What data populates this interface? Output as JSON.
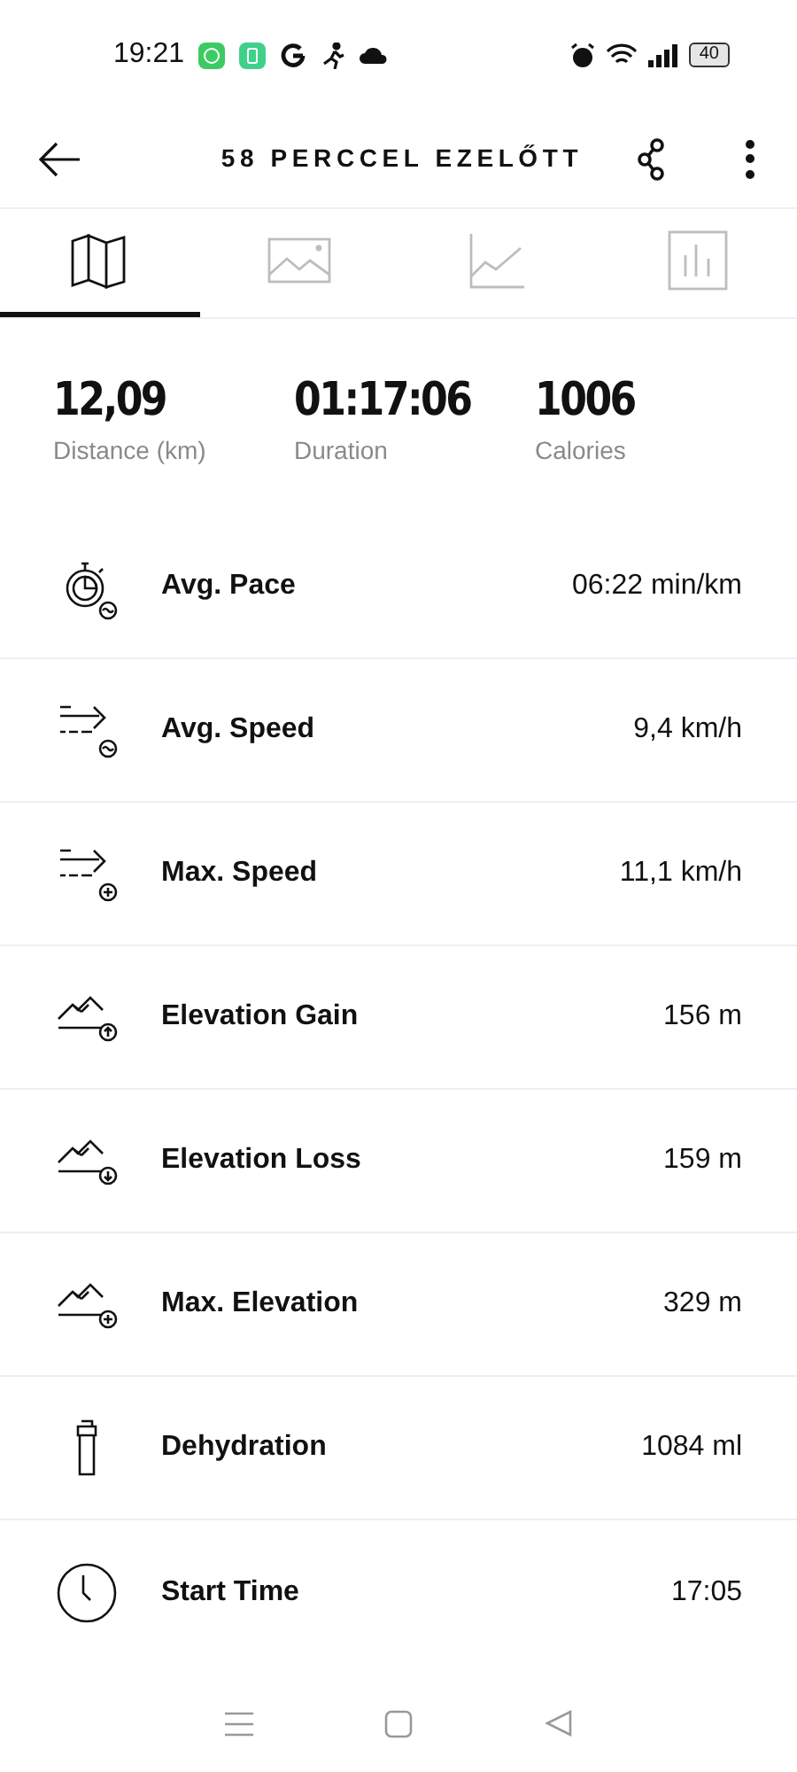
{
  "status_bar": {
    "time": "19:21",
    "battery": "40"
  },
  "header": {
    "title": "58 PERCCEL EZELŐTT"
  },
  "tabs": [
    {
      "kind": "map",
      "selected": true
    },
    {
      "kind": "photo",
      "selected": false
    },
    {
      "kind": "line",
      "selected": false
    },
    {
      "kind": "bars",
      "selected": false
    }
  ],
  "summary": [
    {
      "value": "12,09",
      "label": "Distance (km)"
    },
    {
      "value": "01:17:06",
      "label": "Duration"
    },
    {
      "value": "1006",
      "label": "Calories"
    }
  ],
  "metrics": [
    {
      "kind": "pace-avg",
      "label": "Avg. Pace",
      "value": "06:22 min/km"
    },
    {
      "kind": "speed-avg",
      "label": "Avg. Speed",
      "value": "9,4 km/h"
    },
    {
      "kind": "speed-max",
      "label": "Max. Speed",
      "value": "11,1 km/h"
    },
    {
      "kind": "elevation-up",
      "label": "Elevation Gain",
      "value": "156 m"
    },
    {
      "kind": "elevation-down",
      "label": "Elevation Loss",
      "value": "159 m"
    },
    {
      "kind": "elevation-max",
      "label": "Max. Elevation",
      "value": "329 m"
    },
    {
      "kind": "bottle",
      "label": "Dehydration",
      "value": "1084 ml"
    },
    {
      "kind": "clock",
      "label": "Start Time",
      "value": "17:05"
    }
  ]
}
